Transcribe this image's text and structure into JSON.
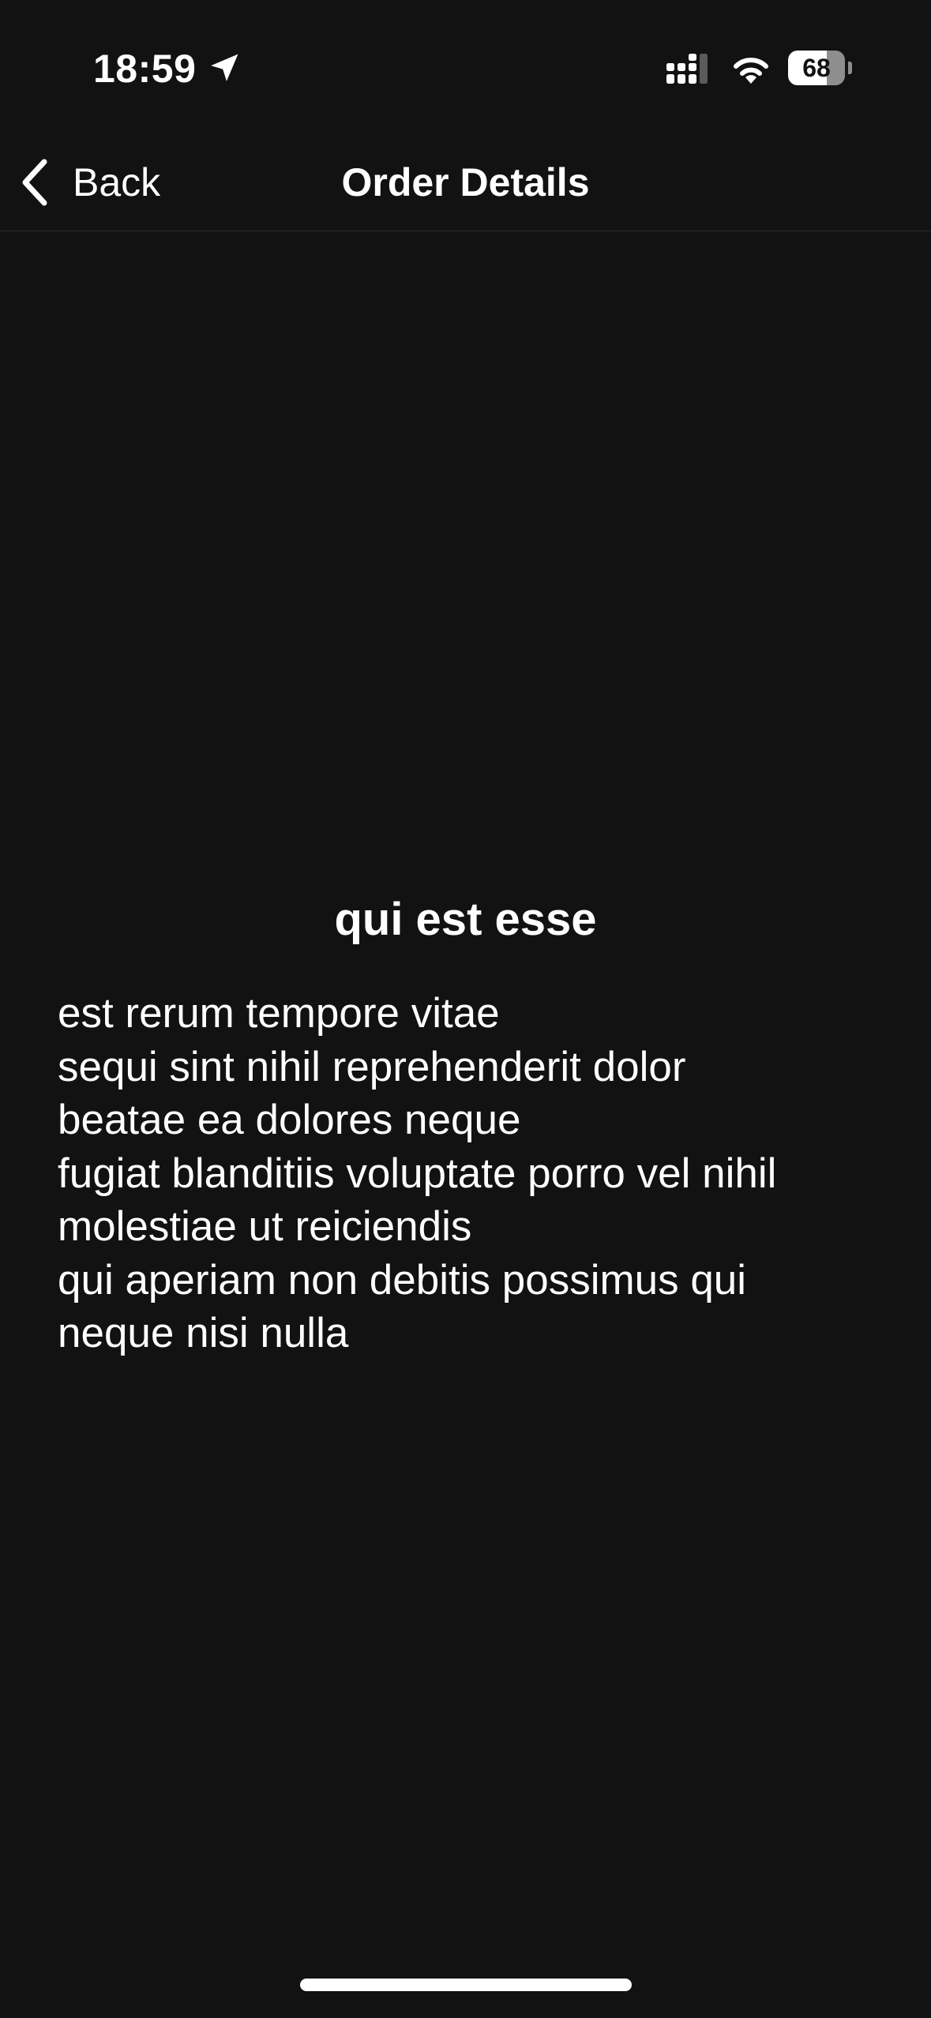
{
  "status_bar": {
    "time": "18:59",
    "battery_level": "68",
    "battery_fraction": 0.68
  },
  "nav": {
    "back_label": "Back",
    "title": "Order Details"
  },
  "post": {
    "title": "qui est esse",
    "body": "est rerum tempore vitae\nsequi sint nihil reprehenderit dolor\nbeatae ea dolores neque\nfugiat blanditiis voluptate porro vel nihil\nmolestiae ut reiciendis\nqui aperiam non debitis possimus qui\nneque nisi nulla"
  },
  "icons": {
    "location": "location-arrow-icon",
    "signal": "cellular-signal-icon",
    "wifi": "wifi-icon",
    "battery": "battery-icon",
    "back": "chevron-left-icon"
  },
  "colors": {
    "background": "#121212",
    "text": "#ffffff",
    "divider": "#2c2c2e",
    "battery_empty": "#8e8e8e"
  }
}
